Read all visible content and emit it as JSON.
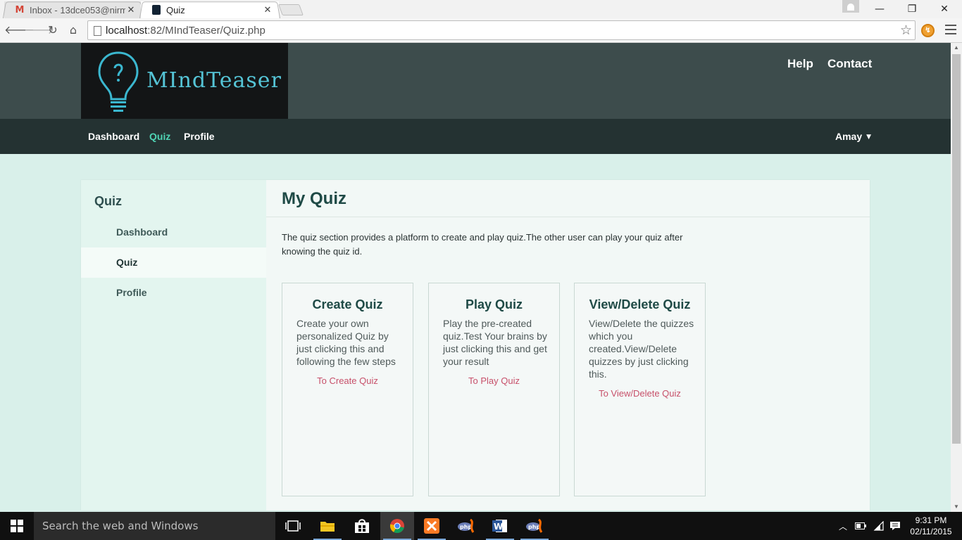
{
  "browser": {
    "tabs": [
      {
        "title": "Inbox - 13dce053@nirma.",
        "favicon": "gmail-icon"
      },
      {
        "title": "Quiz",
        "favicon": "mindteaser-favicon"
      }
    ],
    "url_host": "localhost",
    "url_rest": ":82/MIndTeaser/Quiz.php"
  },
  "site": {
    "logo_text": "MIndTeaser",
    "top_links": {
      "help": "Help",
      "contact": "Contact"
    },
    "nav": {
      "dashboard": "Dashboard",
      "quiz": "Quiz",
      "profile": "Profile"
    },
    "user": "Amay"
  },
  "sidebar": {
    "title": "Quiz",
    "items": [
      {
        "label": "Dashboard"
      },
      {
        "label": "Quiz",
        "active": true
      },
      {
        "label": "Profile"
      }
    ]
  },
  "main": {
    "title": "My Quiz",
    "description": "The quiz section provides a platform to create and play quiz.The other user can play your quiz after knowing the quiz id.",
    "cards": [
      {
        "title": "Create Quiz",
        "text": "Create your own personalized Quiz by just clicking this and following the few steps",
        "link": "To Create Quiz"
      },
      {
        "title": "Play Quiz",
        "text": "Play the pre-created quiz.Test Your brains by just clicking this and get your result",
        "link": "To Play Quiz"
      },
      {
        "title": "View/Delete Quiz",
        "text": "View/Delete the quizzes which you created.View/Delete quizzes by just clicking this.",
        "link": "To View/Delete Quiz"
      }
    ]
  },
  "taskbar": {
    "search_placeholder": "Search the web and Windows",
    "time": "9:31 PM",
    "date": "02/11/2015"
  },
  "colors": {
    "header_bg": "#3d4c4c",
    "nav_bg": "#243232",
    "nav_active": "#4fd4b4",
    "page_bg": "#d9f0ea",
    "link_color": "#c7506a",
    "heading_color": "#1f4a46"
  }
}
